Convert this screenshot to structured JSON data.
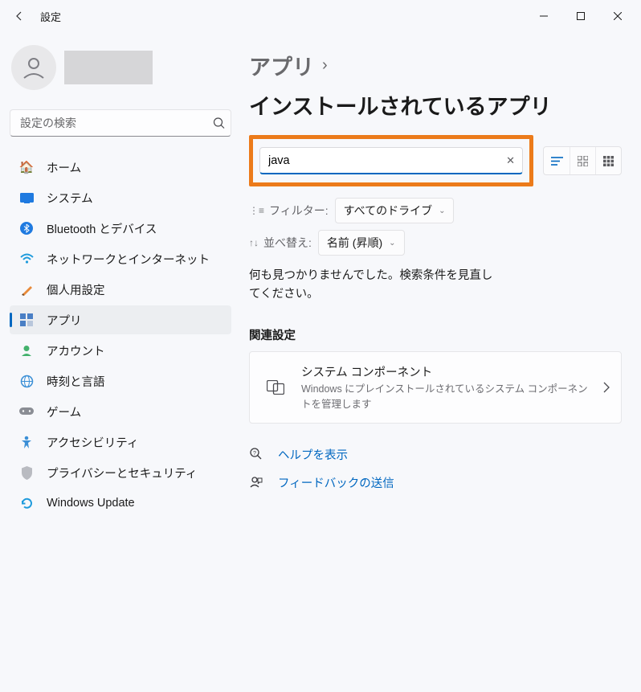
{
  "window": {
    "title": "設定"
  },
  "sidebar": {
    "search_placeholder": "設定の検索",
    "items": [
      {
        "label": "ホーム"
      },
      {
        "label": "システム"
      },
      {
        "label": "Bluetooth とデバイス"
      },
      {
        "label": "ネットワークとインターネット"
      },
      {
        "label": "個人用設定"
      },
      {
        "label": "アプリ"
      },
      {
        "label": "アカウント"
      },
      {
        "label": "時刻と言語"
      },
      {
        "label": "ゲーム"
      },
      {
        "label": "アクセシビリティ"
      },
      {
        "label": "プライバシーとセキュリティ"
      },
      {
        "label": "Windows Update"
      }
    ]
  },
  "main": {
    "breadcrumb_parent": "アプリ",
    "breadcrumb_current": "インストールされているアプリ",
    "app_search_value": "java",
    "filter_label": "フィルター:",
    "filter_value": "すべてのドライブ",
    "sort_label": "並べ替え:",
    "sort_value": "名前 (昇順)",
    "empty_message": "何も見つかりませんでした。検索条件を見直してください。",
    "related_heading": "関連設定",
    "card": {
      "title": "システム コンポーネント",
      "desc": "Windows にプレインストールされているシステム コンポーネントを管理します"
    },
    "help_link": "ヘルプを表示",
    "feedback_link": "フィードバックの送信"
  }
}
